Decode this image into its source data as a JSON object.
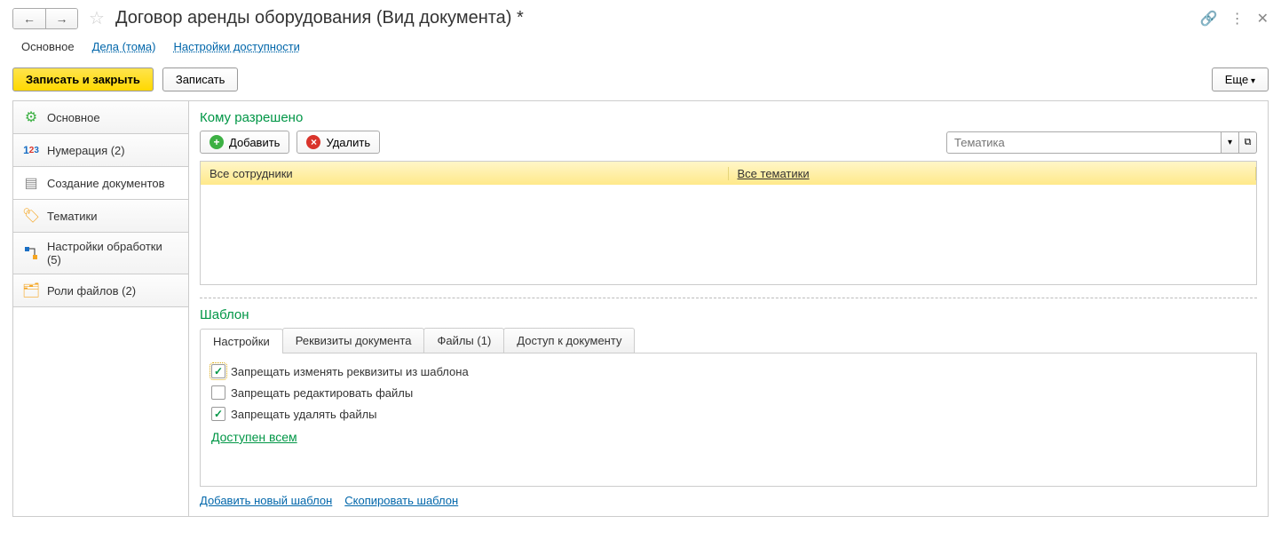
{
  "header": {
    "title": "Договор аренды оборудования (Вид документа) *"
  },
  "topTabs": {
    "main": "Основное",
    "cases": "Дела (тома)",
    "access": "Настройки доступности"
  },
  "toolbar": {
    "saveClose": "Записать и закрыть",
    "save": "Записать",
    "more": "Еще"
  },
  "sidebar": {
    "main": "Основное",
    "numbering": "Нумерация (2)",
    "docCreate": "Создание документов",
    "topics": "Тематики",
    "processing": "Настройки обработки (5)",
    "fileRoles": "Роли файлов (2)"
  },
  "perm": {
    "title": "Кому разрешено",
    "add": "Добавить",
    "delete": "Удалить",
    "topicPlaceholder": "Тематика",
    "col1": "Все сотрудники",
    "col2": "Все тематики"
  },
  "template": {
    "title": "Шаблон",
    "tabs": {
      "settings": "Настройки",
      "props": "Реквизиты документа",
      "files": "Файлы (1)",
      "access": "Доступ к документу"
    },
    "chk1": "Запрещать изменять реквизиты из шаблона",
    "chk2": "Запрещать редактировать файлы",
    "chk3": "Запрещать удалять файлы",
    "availAll": "Доступен всем",
    "addTpl": "Добавить новый шаблон",
    "copyTpl": "Скопировать шаблон"
  }
}
